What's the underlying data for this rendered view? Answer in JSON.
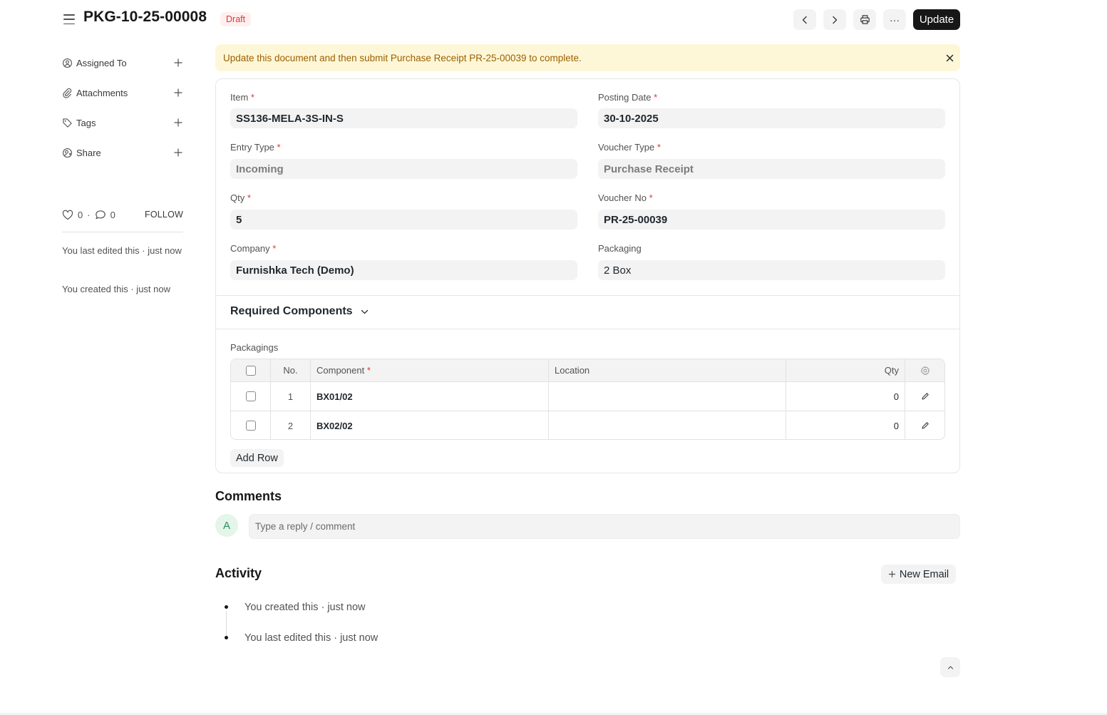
{
  "header": {
    "title": "PKG-10-25-00008",
    "status": "Draft",
    "update_label": "Update",
    "more_label": "···"
  },
  "sidebar": {
    "items": [
      {
        "label": "Assigned To",
        "icon": "user-assign-icon"
      },
      {
        "label": "Attachments",
        "icon": "paperclip-icon"
      },
      {
        "label": "Tags",
        "icon": "tag-icon"
      },
      {
        "label": "Share",
        "icon": "share-user-icon"
      }
    ],
    "likes": "0",
    "comments": "0",
    "dot_sep": "·",
    "follow_label": "FOLLOW",
    "last_edited": "You last edited this · just now",
    "created": "You created this · just now"
  },
  "banner": {
    "message": "Update this document and then submit Purchase Receipt PR-25-00039 to complete."
  },
  "form": {
    "required_mark": "*",
    "item": {
      "label": "Item",
      "value": "SS136-MELA-3S-IN-S"
    },
    "posting_date": {
      "label": "Posting Date",
      "value": "30-10-2025"
    },
    "entry_type": {
      "label": "Entry Type",
      "value": "Incoming"
    },
    "voucher_type": {
      "label": "Voucher Type",
      "value": "Purchase Receipt"
    },
    "qty": {
      "label": "Qty",
      "value": "5"
    },
    "voucher_no": {
      "label": "Voucher No",
      "value": "PR-25-00039"
    },
    "company": {
      "label": "Company",
      "value": "Furnishka Tech (Demo)"
    },
    "packaging": {
      "label": "Packaging",
      "value": "2 Box"
    }
  },
  "required_components": {
    "title": "Required Components",
    "table_label": "Packagings",
    "columns": {
      "no": "No.",
      "component": "Component",
      "location": "Location",
      "qty": "Qty"
    },
    "rows": [
      {
        "no": "1",
        "component": "BX01/02",
        "location": "",
        "qty": "0"
      },
      {
        "no": "2",
        "component": "BX02/02",
        "location": "",
        "qty": "0"
      }
    ],
    "add_row_label": "Add Row"
  },
  "comments": {
    "title": "Comments",
    "avatar_initial": "A",
    "placeholder": "Type a reply / comment"
  },
  "activity": {
    "title": "Activity",
    "new_email_label": "New Email",
    "items": [
      "You created this · just now",
      "You last edited this · just now"
    ]
  },
  "colors": {
    "accent": "#171717",
    "draft_badge_bg": "#fff0f0",
    "draft_badge_text": "#e03636",
    "banner_bg": "#fef7d7",
    "banner_text": "#9c5f00"
  }
}
